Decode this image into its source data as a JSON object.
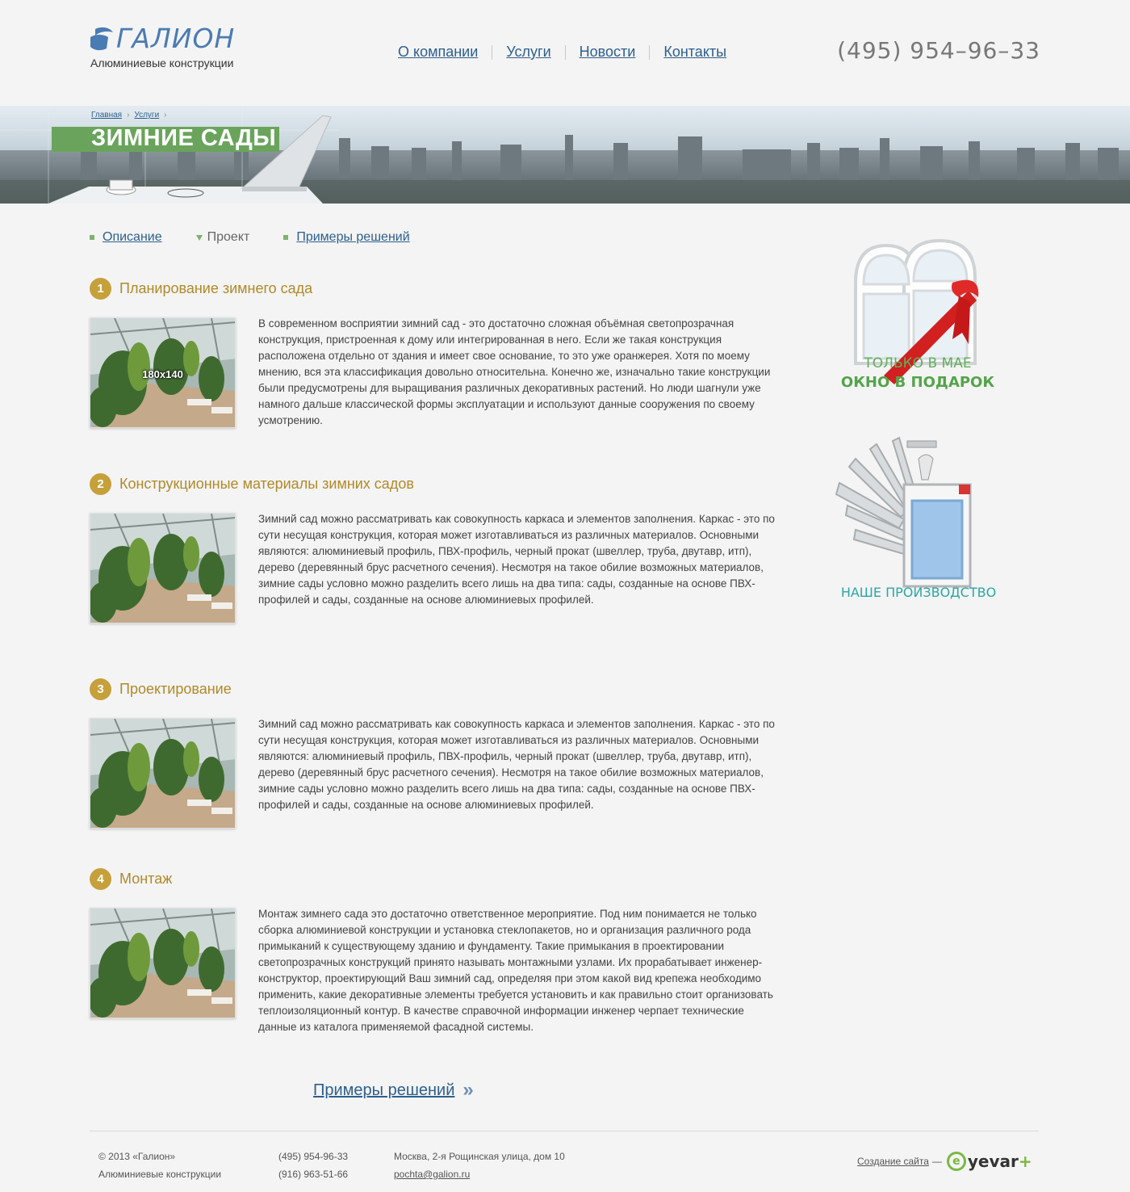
{
  "header": {
    "logo_text": "ГАЛИОН",
    "logo_subtitle": "Алюминиевые конструкции",
    "nav": [
      {
        "label": "О компании"
      },
      {
        "label": "Услуги"
      },
      {
        "label": "Новости"
      },
      {
        "label": "Контакты"
      }
    ],
    "phone": "(495) 954–96–33"
  },
  "banner": {
    "breadcrumb": [
      {
        "label": "Главная"
      },
      {
        "label": "Услуги"
      }
    ],
    "title": "ЗИМНИЕ САДЫ"
  },
  "tabs": [
    {
      "label": "Описание",
      "active": false
    },
    {
      "label": "Проект",
      "active": true
    },
    {
      "label": "Примеры решений",
      "active": false
    }
  ],
  "sections": [
    {
      "number": "1",
      "title": "Планирование зимнего сада",
      "thumb_label": "180x140",
      "text": "В современном восприятии зимний сад - это достаточно сложная объёмная светопрозрачная конструкция, пристроенная к дому или интегрированная в него. Если же такая конструкция расположена отдельно от здания и имеет свое основание, то это уже оранжерея. Хотя по моему мнению, вся эта классификация довольно относительна. Конечно же, изначально такие конструкции были предусмотрены для выращивания различных декоративных растений. Но люди шагнули уже намного дальше классической формы эксплуатации и используют данные сооружения по своему усмотрению."
    },
    {
      "number": "2",
      "title": "Конструкционные материалы зимних садов",
      "text": "Зимний сад можно рассматривать как совокупность каркаса и элементов заполнения. Каркас - это по сути несущая конструкция, которая может изготавливаться из различных материалов. Основными являются: алюминиевый профиль, ПВХ-профиль, черный прокат (швеллер, труба, двутавр, итп), дерево (деревянный брус расчетного сечения). Несмотря на такое обилие возможных материалов, зимние сады условно можно разделить всего лишь на два типа: сады, созданные на основе ПВХ-профилей и сады, созданные на основе алюминиевых профилей."
    },
    {
      "number": "3",
      "title": "Проектирование",
      "text": "Зимний сад можно рассматривать как совокупность каркаса и элементов заполнения. Каркас - это по сути несущая конструкция, которая может изготавливаться из различных материалов. Основными являются: алюминиевый профиль, ПВХ-профиль, черный прокат (швеллер, труба, двутавр, итп), дерево (деревянный брус расчетного сечения). Несмотря на такое обилие возможных материалов, зимние сады условно можно разделить всего лишь на два типа: сады, созданные на основе ПВХ-профилей и сады, созданные на основе алюминиевых профилей."
    },
    {
      "number": "4",
      "title": "Монтаж",
      "text": "Монтаж зимнего сада это достаточно ответственное мероприятие. Под ним понимается не только сборка алюминиевой конструкции и установка стеклопакетов, но и организация различного рода примыканий к существующему зданию и фундаменту. Такие примыкания в проектировании светопрозрачных конструкций принято называть монтажными узлами. Их прорабатывает инженер-конструктор, проектирующий Ваш зимний сад, определяя при этом какой вид крепежа необходимо применить, какие декоративные элементы требуется установить и как правильно стоит организовать теплоизоляционный контур. В качестве справочной информации инженер черпает технические данные из каталога применяемой фасадной системы."
    }
  ],
  "promos": {
    "gift_line1": "ТОЛЬКО В МАЕ",
    "gift_line2": "ОКНО В ПОДАРОК",
    "production": "НАШЕ ПРОИЗВОДСТВО"
  },
  "more_link": {
    "label": "Примеры решений",
    "chevron": "»"
  },
  "footer": {
    "copyright": "© 2013  «Галион»",
    "company_desc": "Алюминиевые конструкции",
    "phone1": "(495) 954-96-33",
    "phone2": "(916) 963-51-66",
    "address": "Москва, 2-я Рощинская улица, дом 10",
    "email": "pochta@galion.ru",
    "dev_label": "Создание сайта",
    "dev_dash": "—",
    "dev_logo": "yevar",
    "dev_logo_e": "e",
    "dev_logo_tail": "+"
  },
  "colors": {
    "accent_link": "#2e5f8e",
    "section_title": "#b08a2a",
    "number_badge": "#c6a03a",
    "title_bar": "#6aa45c",
    "promo_green": "#54a44a",
    "promo_teal": "#2ba7a3"
  }
}
